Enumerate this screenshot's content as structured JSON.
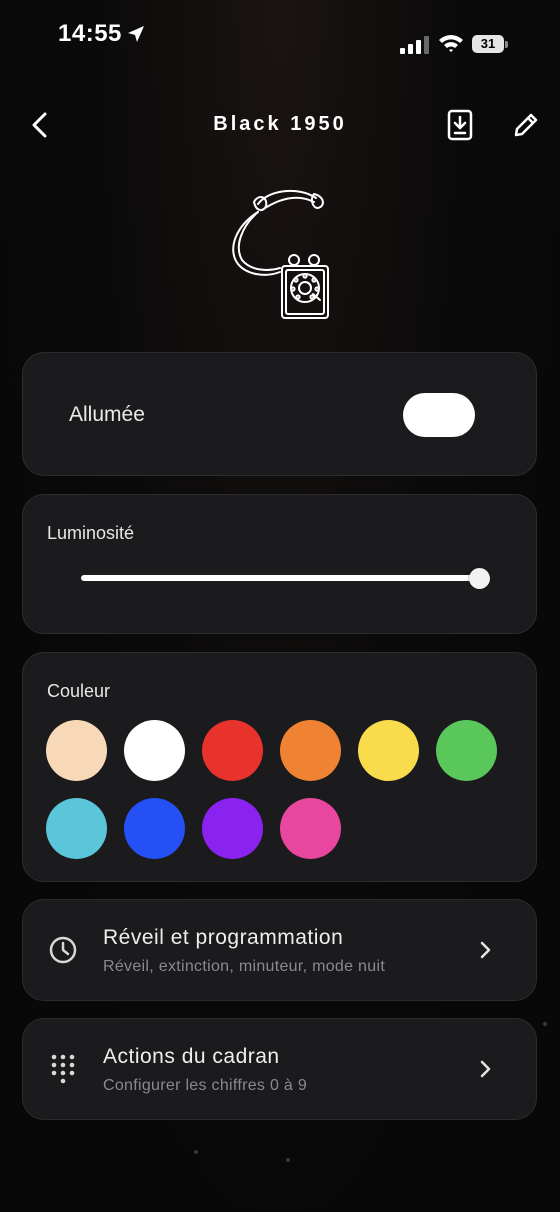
{
  "status_bar": {
    "time": "14:55",
    "battery": "31",
    "icons": [
      "location-arrow-icon",
      "cellular-signal-icon",
      "wifi-icon",
      "battery-icon"
    ]
  },
  "nav": {
    "title": "Black 1950",
    "back_icon": "chevron-left-icon",
    "download_icon": "download-to-device-icon",
    "edit_icon": "pencil-icon"
  },
  "device_image": "vintage-rotary-phone-illustration",
  "power": {
    "label": "Allumée",
    "on": true
  },
  "brightness": {
    "label": "Luminosité",
    "value_fraction": 1.0
  },
  "color": {
    "label": "Couleur",
    "swatches": [
      "#f7d9b7",
      "#ffffff",
      "#e8332c",
      "#ef8233",
      "#f9dc4c",
      "#59c75a",
      "#5bc6da",
      "#2450f5",
      "#8a22f0",
      "#e8469f"
    ]
  },
  "links": [
    {
      "title": "Réveil et programmation",
      "subtitle": "Réveil, extinction, minuteur, mode nuit",
      "icon": "clock-icon"
    },
    {
      "title": "Actions du cadran",
      "subtitle": "Configurer les chiffres 0 à 9",
      "icon": "dial-pad-icon"
    }
  ]
}
